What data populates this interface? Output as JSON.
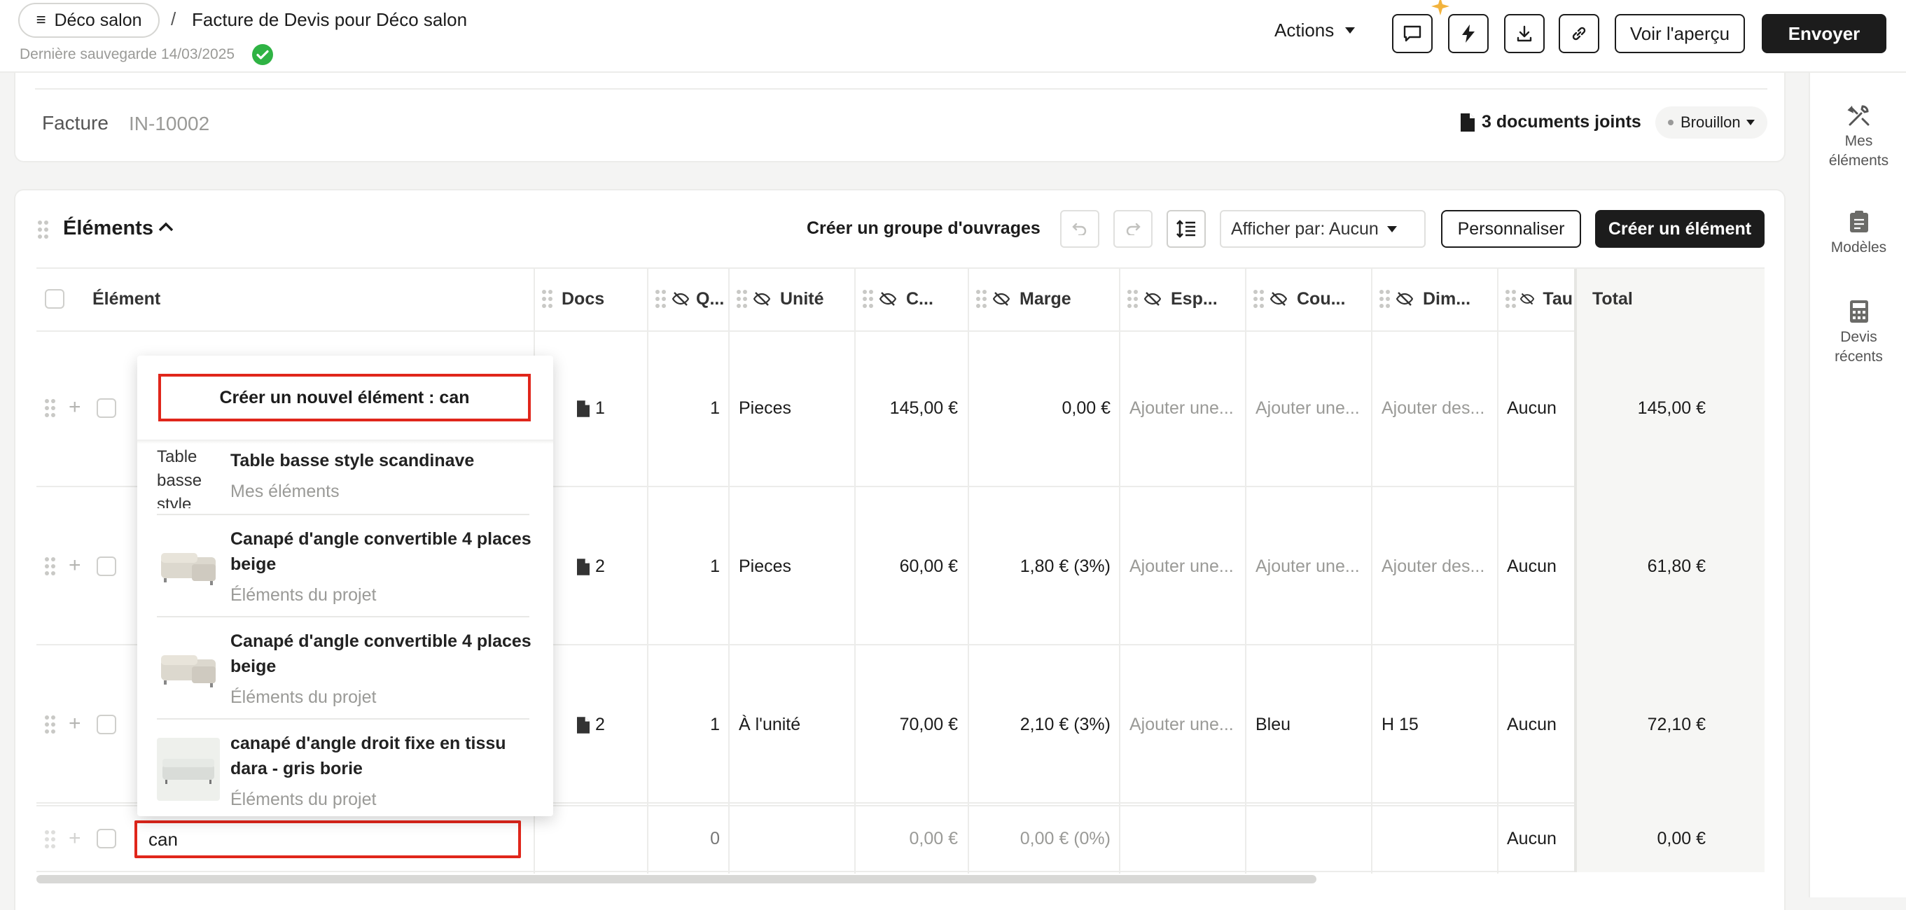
{
  "header": {
    "project_label": "Déco salon",
    "breadcrumb_sep": "/",
    "doc_title": "Facture de Devis pour Déco salon",
    "last_saved": "Dernière sauvegarde 14/03/2025",
    "actions_label": "Actions",
    "preview_label": "Voir l'aperçu",
    "send_label": "Envoyer"
  },
  "invoice": {
    "type_label": "Facture",
    "number": "IN-10002",
    "attachments": "3 documents joints",
    "status": "Brouillon"
  },
  "elements": {
    "section_title": "Éléments",
    "create_group": "Créer un groupe d'ouvrages",
    "display_by": "Afficher par: Aucun",
    "customize": "Personnaliser",
    "create_element": "Créer un élément",
    "columns": [
      "Élément",
      "Docs",
      "Q...",
      "Unité",
      "C...",
      "Marge",
      "Esp...",
      "Cou...",
      "Dim...",
      "Tau",
      "Total"
    ],
    "rows": [
      {
        "docs": "1",
        "qty": "1",
        "unit": "Pieces",
        "cost": "145,00 €",
        "margin": "0,00 €",
        "esp": "Ajouter une...",
        "cou": "Ajouter une...",
        "dim": "Ajouter des...",
        "tax": "Aucun",
        "total": "145,00 €"
      },
      {
        "docs": "2",
        "qty": "1",
        "unit": "Pieces",
        "cost": "60,00 €",
        "margin": "1,80 € (3%)",
        "esp": "Ajouter une...",
        "cou": "Ajouter une...",
        "dim": "Ajouter des...",
        "tax": "Aucun",
        "total": "61,80 €"
      },
      {
        "docs": "2",
        "qty": "1",
        "unit": "À l'unité",
        "cost": "70,00 €",
        "margin": "2,10 € (3%)",
        "esp": "Ajouter une...",
        "cou": "Bleu",
        "dim": "H 15",
        "tax": "Aucun",
        "total": "72,10 €"
      }
    ],
    "new_row": {
      "input_value": "can",
      "qty": "0",
      "cost": "0,00 €",
      "margin": "0,00 € (0%)",
      "tax": "Aucun",
      "total": "0,00 €"
    }
  },
  "dropdown": {
    "create_new": "Créer un nouvel élément : can",
    "options": [
      {
        "title": "Table basse style scandinave",
        "source": "Mes éléments",
        "alt": "Table basse style"
      },
      {
        "title": "Canapé d'angle convertible 4 places beige",
        "source": "Éléments du projet"
      },
      {
        "title": "Canapé d'angle convertible 4 places beige",
        "source": "Éléments du projet"
      },
      {
        "title": "canapé d'angle droit fixe en tissu dara - gris borie",
        "source": "Éléments du projet"
      }
    ]
  },
  "right_panel": {
    "items": [
      {
        "label": "Mes éléments",
        "icon": "tools-icon"
      },
      {
        "label": "Modèles",
        "icon": "clipboard-icon"
      },
      {
        "label": "Devis récents",
        "icon": "calculator-icon"
      }
    ]
  },
  "colors": {
    "accent_dark": "#1c1c1c",
    "highlight_red": "#e0261b",
    "success_green": "#2fb344"
  }
}
